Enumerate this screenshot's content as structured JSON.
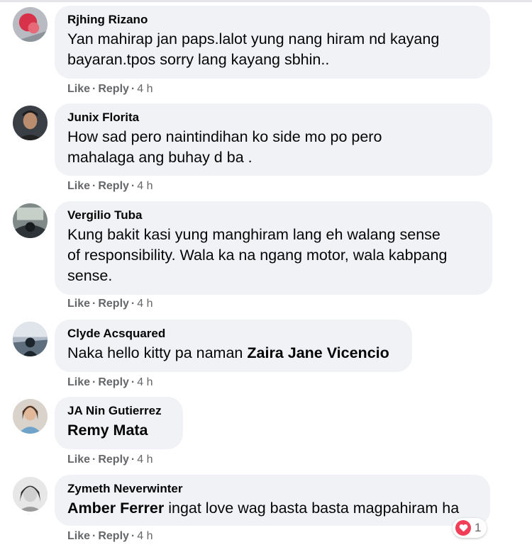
{
  "comments": [
    {
      "author": "Rjhing Rizano",
      "text": "Yan mahirap jan paps.lalot yung nang hiram nd kayang\nbayaran.tpos sorry lang kayang sbhin..",
      "mention": "",
      "time": "4 h"
    },
    {
      "author": "Junix Florita",
      "text": "How sad pero naintindihan ko side mo po pero\nmahalaga ang buhay d ba .",
      "mention": "",
      "time": "4 h"
    },
    {
      "author": "Vergilio Tuba",
      "text": "Kung bakit kasi yung manghiram lang eh walang sense\nof responsibility. Wala ka na ngang motor, wala kabpang\nsense.",
      "mention": "",
      "time": "4 h"
    },
    {
      "author": "Clyde Acsquared",
      "text": "Naka hello kitty pa naman ",
      "mention": "Zaira Jane Vicencio",
      "time": "4 h"
    },
    {
      "author": "JA Nin Gutierrez",
      "text": "",
      "mention": "Remy Mata",
      "time": "4 h"
    },
    {
      "author": "Zymeth Neverwinter",
      "text": " ingat love wag basta basta magpahiram ha",
      "mention": "Amber Ferrer",
      "time": "4 h"
    }
  ],
  "actions": {
    "like": "Like",
    "reply": "Reply",
    "dot": "·"
  },
  "reaction": {
    "icon": "heart-icon",
    "count": "1",
    "color": "#f33e58"
  }
}
